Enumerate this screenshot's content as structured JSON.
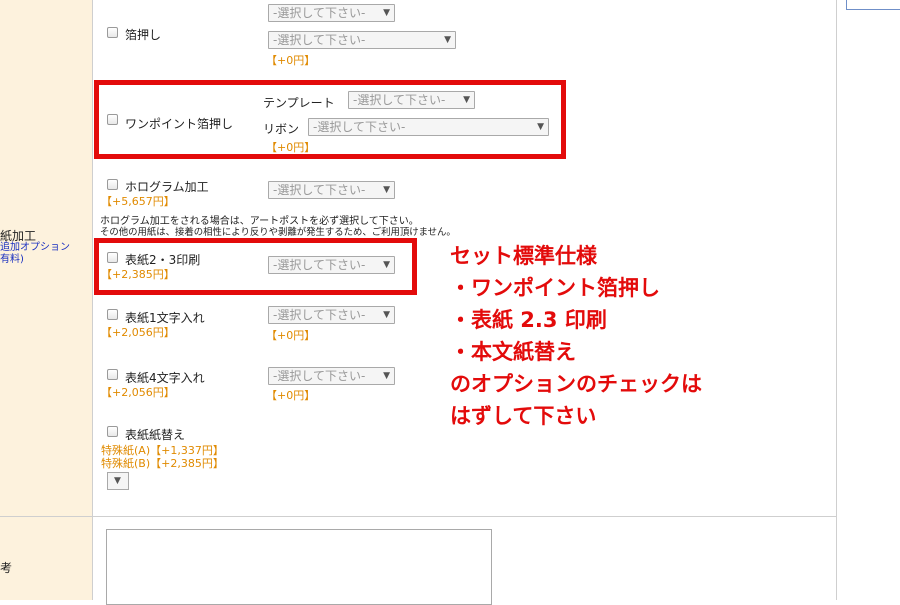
{
  "options": {
    "haku": {
      "label": "箔押し",
      "select1": "-選択して下さい-",
      "select2": "-選択して下さい-",
      "price": "【+0円】"
    },
    "onepoint": {
      "label": "ワンポイント箔押し",
      "template_label": "テンプレート",
      "template_select": "-選択して下さい-",
      "ribbon_label": "リボン",
      "ribbon_select": "-選択して下さい-",
      "price": "【+0円】"
    },
    "hologram": {
      "label": "ホログラム加工",
      "price": "【+5,657円】",
      "select": "-選択して下さい-",
      "note_line1": "ホログラム加工をされる場合は、アートポストを必ず選択して下さい。",
      "note_line2": "その他の用紙は、接着の相性により反りや剥離が発生するため、ご利用頂けません。"
    },
    "cover23": {
      "label": "表紙2・3印刷",
      "price": "【+2,385円】",
      "select": "-選択して下さい-"
    },
    "cover1text": {
      "label": "表紙1文字入れ",
      "price": "【+2,056円】",
      "select": "-選択して下さい-",
      "price2": "【+0円】"
    },
    "cover4text": {
      "label": "表紙4文字入れ",
      "price": "【+2,056円】",
      "select": "-選択して下さい-",
      "price2": "【+0円】"
    },
    "coverpaper": {
      "label": "表紙紙替え",
      "special_a": "特殊紙(A)【+1,337円】",
      "special_b": "特殊紙(B)【+2,385円】"
    }
  },
  "category": {
    "title": "紙加工",
    "sub1": "追加オプション",
    "sub2": "有料)"
  },
  "remarks": {
    "label": "考"
  },
  "annotation": {
    "lines": [
      "セット標準仕様",
      "・ワンポイント箔押し",
      "・表紙 2.3 印刷",
      "・本文紙替え",
      "のオプションのチェックは",
      "はずして下さい"
    ],
    "color": "#e30b0b"
  },
  "colors": {
    "label_bg": "#fdf2dd",
    "price": "#e08a00",
    "highlight": "#e30b0b",
    "subtext": "#1a30c0"
  }
}
